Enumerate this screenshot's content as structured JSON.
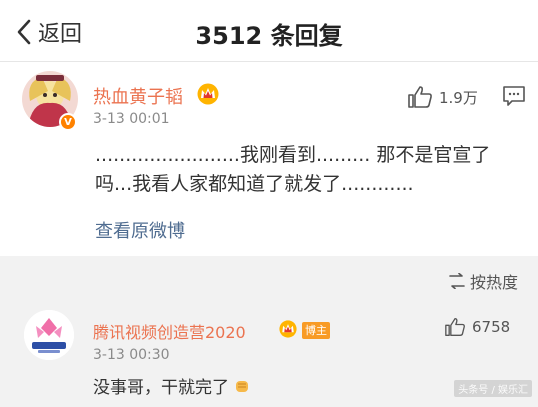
{
  "header": {
    "back_label": "返回",
    "title": "3512 条回复"
  },
  "post": {
    "username": "热血黄子韬",
    "verified_badge": "V",
    "time": "3-13 00:01",
    "likes": "1.9万",
    "text": "........................我刚看到......... 那不是官宣了吗...我看人家都知道了就发了............",
    "view_original": "查看原微博"
  },
  "replies": {
    "sort_label": "按热度",
    "items": [
      {
        "username": "腾讯视频创造营2020",
        "badge": "博主",
        "time": "3-13 00:30",
        "likes": "6758",
        "text": "没事哥，干就完了"
      }
    ]
  },
  "watermark": "头条号 / 娱乐汇",
  "colors": {
    "accent_name": "#eb7350",
    "link": "#4f6c90",
    "badge_orange": "#f89b26",
    "reply_bg": "#f2f2f2"
  },
  "icons": [
    "chevron-left-icon",
    "crown-icon",
    "thumbs-up-icon",
    "comment-icon",
    "sort-icon",
    "fist-emoji-icon"
  ]
}
